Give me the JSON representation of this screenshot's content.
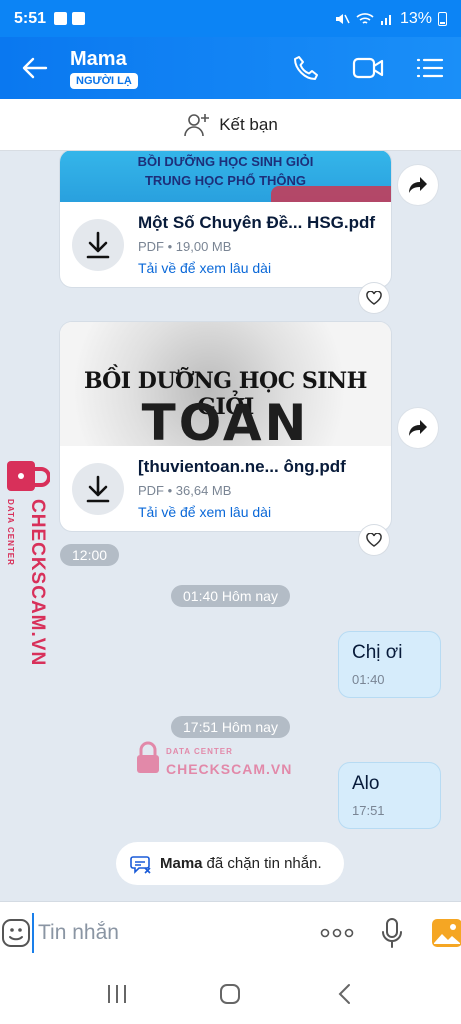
{
  "status_bar": {
    "time": "5:51",
    "battery": "13%"
  },
  "header": {
    "contact_name": "Mama",
    "badge": "NGƯỜI LẠ"
  },
  "add_friend": {
    "label": "Kết bạn"
  },
  "messages": {
    "file1": {
      "thumb_line1": "BỒI DƯỠNG HỌC SINH GIỎI",
      "thumb_line2": "TRUNG HỌC PHỔ THÔNG",
      "name": "Một Số Chuyên Đề... HSG.pdf",
      "meta": "PDF • 19,00 MB",
      "link": "Tải về để xem lâu dài"
    },
    "file2": {
      "thumb_line1": "BỒI DƯỠNG HỌC SINH GIỎI",
      "thumb_line2": "TOÁN",
      "name": "[thuvientoan.ne... ông.pdf",
      "meta": "PDF • 36,64 MB",
      "link": "Tải về để xem lâu dài"
    },
    "time_1200": "12:00",
    "divider1": "01:40 Hôm nay",
    "bubble1": {
      "text": "Chị ơi",
      "time": "01:40"
    },
    "divider2": "17:51 Hôm nay",
    "bubble2": {
      "text": "Alo",
      "time": "17:51"
    },
    "blocked_notice": {
      "name": "Mama",
      "text": "đã chặn tin nhắn."
    }
  },
  "watermark": {
    "line1": "CHECKSCAM.VN",
    "line2": "DATA CENTER"
  },
  "composer": {
    "placeholder": "Tin nhắn"
  },
  "colors": {
    "accent": "#0c84f5",
    "bubble": "#d6ecfb",
    "watermark": "#d8305a"
  }
}
